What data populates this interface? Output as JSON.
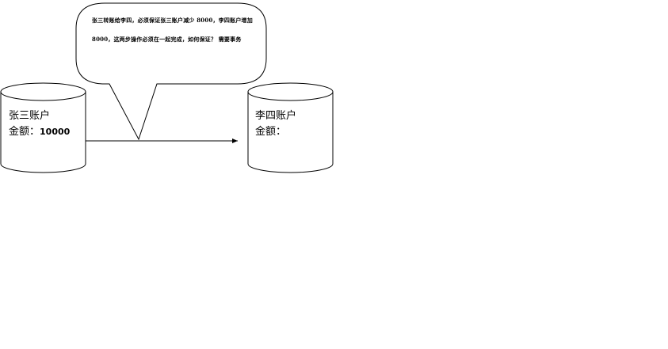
{
  "callout": {
    "text": "张三转账给李四，必须保证张三账户减少 8000，李四账户增加 8000，这两步操作必须在一起完成，如何保证？  需要事务"
  },
  "account_a": {
    "name": "张三账户",
    "amount_label": "金额：",
    "amount_value": "10000"
  },
  "account_b": {
    "name": "李四账户",
    "amount_label": "金额：",
    "amount_value": ""
  },
  "colors": {
    "stroke": "#000000",
    "fill": "#ffffff"
  }
}
